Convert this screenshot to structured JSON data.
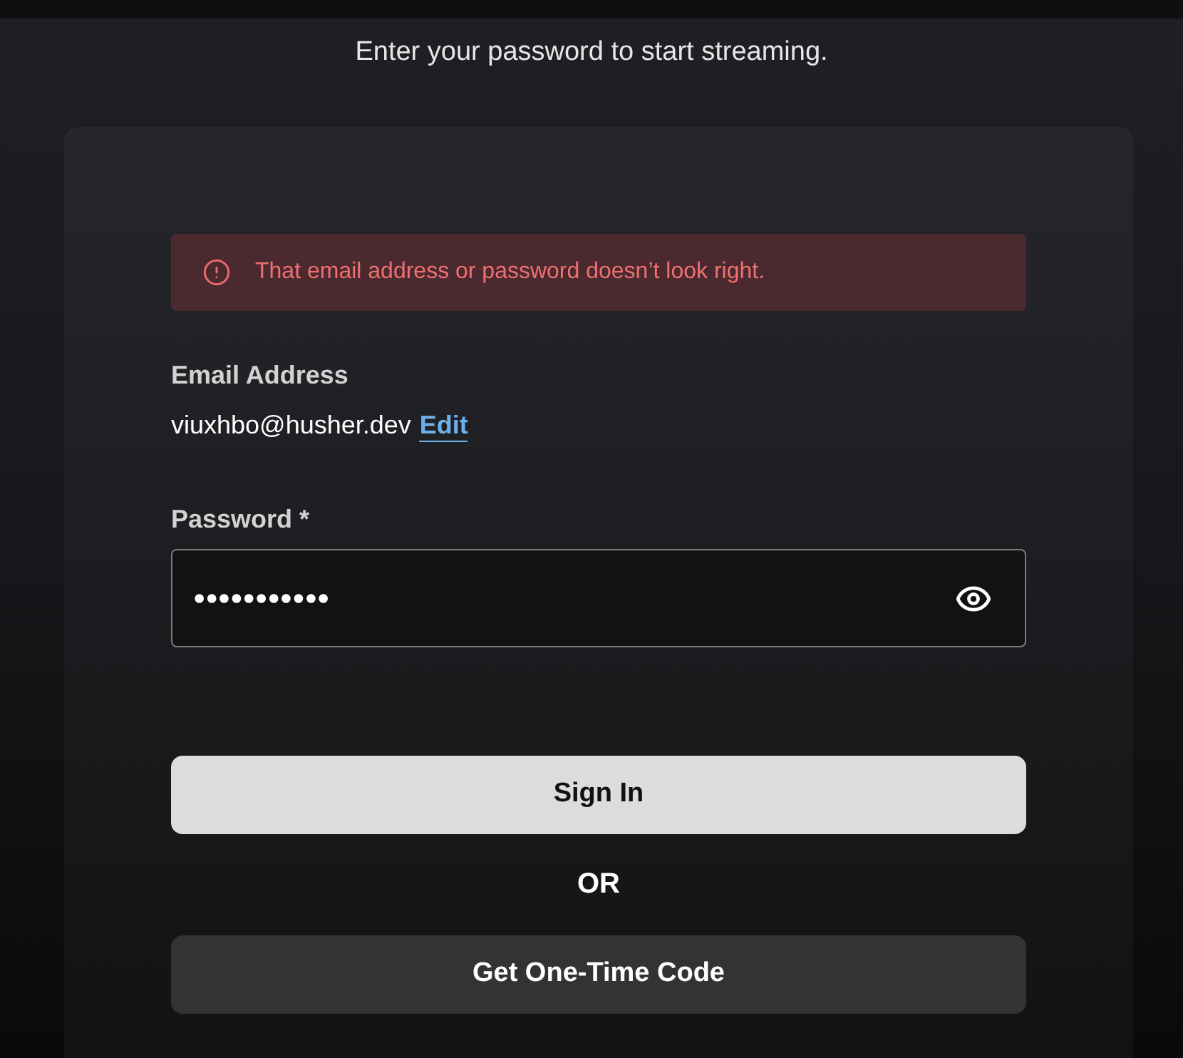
{
  "subtitle": "Enter your password to start streaming.",
  "error_banner": {
    "message": "That email address or password doesn’t look right."
  },
  "email": {
    "label": "Email Address",
    "value": "viuxhbo@husher.dev",
    "edit_link": "Edit"
  },
  "password": {
    "label": "Password *",
    "value": "•••••••••••"
  },
  "actions": [
    {
      "kind": "primary",
      "label": "Sign In"
    },
    {
      "kind": "divider",
      "label": "OR"
    },
    {
      "kind": "secondary",
      "label": "Get One-Time Code"
    }
  ]
}
